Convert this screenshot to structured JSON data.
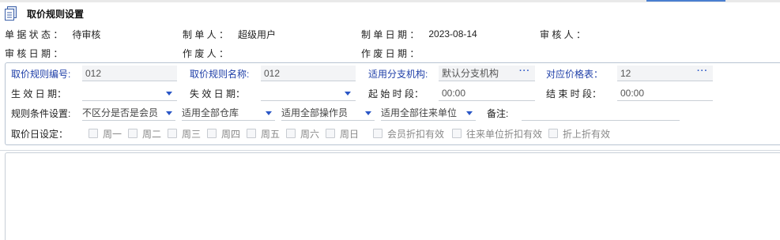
{
  "page": {
    "title": "取价规则设置"
  },
  "info": {
    "status_label": "单 据 状 态 ：",
    "status_value": "待审核",
    "creator_label": "制   单   人   ：",
    "creator_value": "超级用户",
    "create_date_label": "制 单 日 期 ：",
    "create_date_value": "2023-08-14",
    "auditor_label": "审   核   人   ：",
    "auditor_value": "",
    "audit_date_label": "审 核 日 期 ：",
    "audit_date_value": "",
    "voider_label": "作   废   人   ：",
    "voider_value": "",
    "void_date_label": "作 废 日 期 ：",
    "void_date_value": ""
  },
  "form": {
    "rule_no_label": "取价规则编号:",
    "rule_no_value": "012",
    "rule_name_label": "取价规则名称:",
    "rule_name_value": "012",
    "branch_label": "适用分支机构:",
    "branch_value": "默认分支机构",
    "price_table_label": "对应价格表：",
    "price_table_value": "12",
    "effective_date_label": "生 效 日 期：",
    "effective_date_value": "",
    "expire_date_label": "失 效 日 期：",
    "expire_date_value": "",
    "start_time_label": "起 始 时 段：",
    "start_time_value": "00:00",
    "end_time_label": "结 束 时 段：",
    "end_time_value": "00:00",
    "condition_label": "规则条件设置:",
    "member_select": "不区分是否是会员",
    "warehouse_select": "适用全部仓库",
    "operator_select": "适用全部操作员",
    "partner_select": "适用全部往来单位",
    "remark_label": "备注:",
    "remark_value": "",
    "price_day_label": "取价日设定：",
    "weekdays": [
      "周一",
      "周二",
      "周三",
      "周四",
      "周五",
      "周六",
      "周日"
    ],
    "member_discount_label": "会员折扣有效",
    "partner_discount_label": "往来单位折扣有效",
    "stacked_discount_label": "折上折有效"
  },
  "icons": {
    "title_icon": "document-icon",
    "lookup_icon": "ellipsis-icon",
    "dropdown_icon": "caret-down-icon"
  },
  "colors": {
    "label_blue": "#1f3fa8",
    "accent_blue": "#2a56c6",
    "panel_border": "#b8c4d2"
  }
}
